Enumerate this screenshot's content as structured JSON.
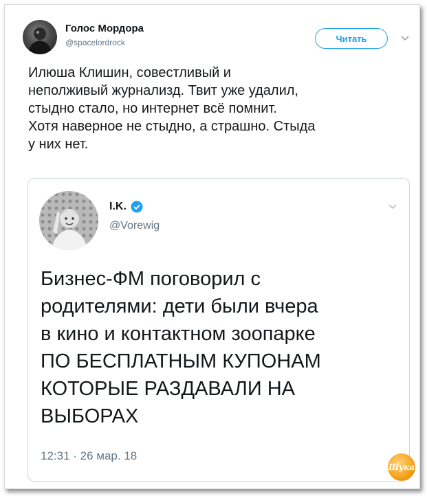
{
  "tweet": {
    "author_name": "Голос Мордора",
    "author_handle": "@spacelordrock",
    "follow_label": "Читать",
    "text": "Илюша Клишин, совестливый и\nнеполживый журнализд. Твит уже удалил,\nстыдно стало, но интернет всё помнит.\nХотя наверное не стыдно, а страшно. Стыда\nу них нет."
  },
  "quoted_tweet": {
    "author_name": "I.K.",
    "author_handle": "@Vorewig",
    "text": "Бизнес-ФМ поговорил с\nродителями: дети были вчера\nв кино и контактном зоопарке\nПО БЕСПЛАТНЫМ КУПОНАМ\nКОТОРЫЕ РАЗДАВАЛИ НА\nВЫБОРАХ",
    "timestamp": "12:31 · 26 мар. 18",
    "verified": true
  },
  "watermark": {
    "text": "Шука"
  },
  "colors": {
    "accent": "#1da1f2",
    "secondary_text": "#657786",
    "primary_text": "#14171a",
    "border": "#ccd6dd",
    "badge": "#f4a21a"
  },
  "icons": {
    "follow_menu": "chevron-down-icon",
    "quote_menu": "chevron-down-icon",
    "verified": "verified-badge-icon"
  }
}
